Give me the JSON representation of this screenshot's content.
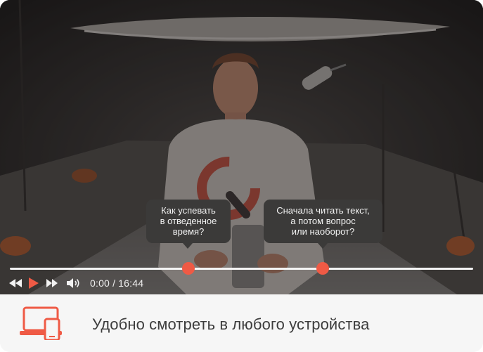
{
  "player": {
    "chapters": [
      {
        "label": "Как успевать\nв отведенное\nвремя?"
      },
      {
        "label": "Сначала читать текст,\nа потом вопрос\nили наоборот?"
      }
    ],
    "time": {
      "current": "0:00",
      "separator": "/",
      "duration": "16:44"
    },
    "controls": {
      "rewind_icon": "rewind-icon",
      "play_icon": "play-icon",
      "forward_icon": "fast-forward-icon",
      "volume_icon": "volume-icon"
    },
    "colors": {
      "accent": "#ef5a45",
      "track": "#f4f4f4"
    }
  },
  "footer": {
    "text": "Удобно смотреть в любого устройства",
    "icon": "devices-icon"
  }
}
